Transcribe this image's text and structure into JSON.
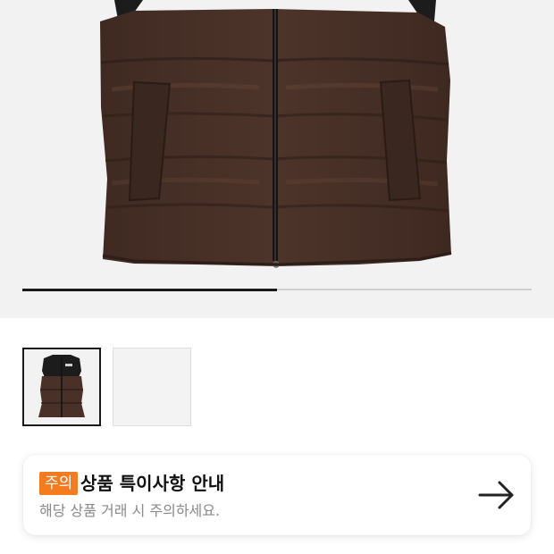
{
  "gallery": {
    "product_image_icon": "puffer-vest-image",
    "progress_fraction": 0.5,
    "thumbnails": [
      {
        "icon": "puffer-vest-thumbnail",
        "selected": true
      },
      {
        "icon": "empty-thumbnail",
        "selected": false
      }
    ]
  },
  "notice": {
    "badge": "주의",
    "title": "상품 특이사항 안내",
    "description": "해당 상품 거래 시 주의하세요.",
    "arrow_icon": "arrow-right-icon"
  },
  "colors": {
    "badge": "#f47b20",
    "vest_brown": "#4a3128",
    "vest_black": "#1c1c1c",
    "hero_background": "#f2f2f2"
  }
}
